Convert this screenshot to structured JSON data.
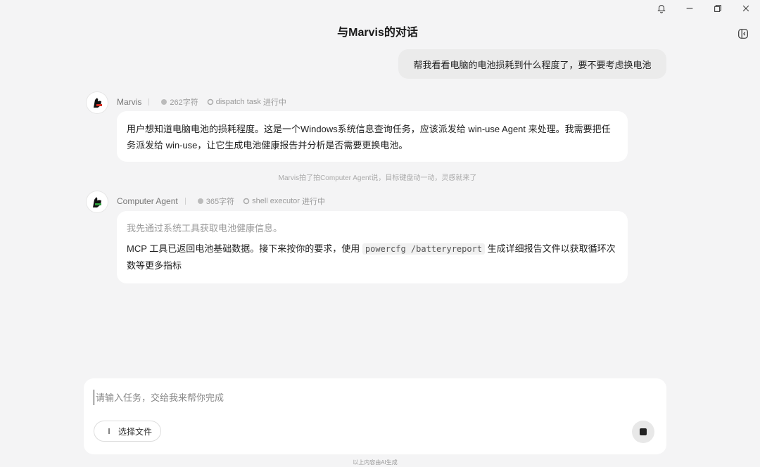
{
  "window": {
    "title": "与Marvis的对话"
  },
  "user_message": "帮我看看电脑的电池损耗到什么程度了，要不要考虑换电池",
  "messages": [
    {
      "agent": "Marvis",
      "char_count": "262字符",
      "task_label": "dispatch task",
      "task_status": "进行中",
      "content": "用户想知道电脑电池的损耗程度。这是一个Windows系统信息查询任务，应该派发给 win-use Agent 来处理。我需要把任务派发给 win-use，让它生成电池健康报告并分析是否需要更换电池。"
    },
    {
      "agent": "Computer Agent",
      "char_count": "365字符",
      "task_label": "shell executor",
      "task_status": "进行中",
      "muted_line": "我先通过系统工具获取电池健康信息。",
      "content_before": "MCP 工具已返回电池基础数据。接下来按你的要求，使用 ",
      "code": "powercfg /batteryreport",
      "content_after": " 生成详细报告文件以获取循环次数等更多指标"
    }
  ],
  "status_line": "Marvis拍了拍Computer Agent说，目标键盘动一动，灵感就来了",
  "composer": {
    "placeholder": "请输入任务，交给我来帮你完成",
    "file_button": "选择文件"
  },
  "footer_note": "以上内容由AI生成",
  "icons": {
    "bell": "bell-icon",
    "minimize": "minimize-icon",
    "restore": "restore-icon",
    "close": "close-icon",
    "sidebar": "sidebar-toggle-icon",
    "stop": "stop-icon"
  }
}
